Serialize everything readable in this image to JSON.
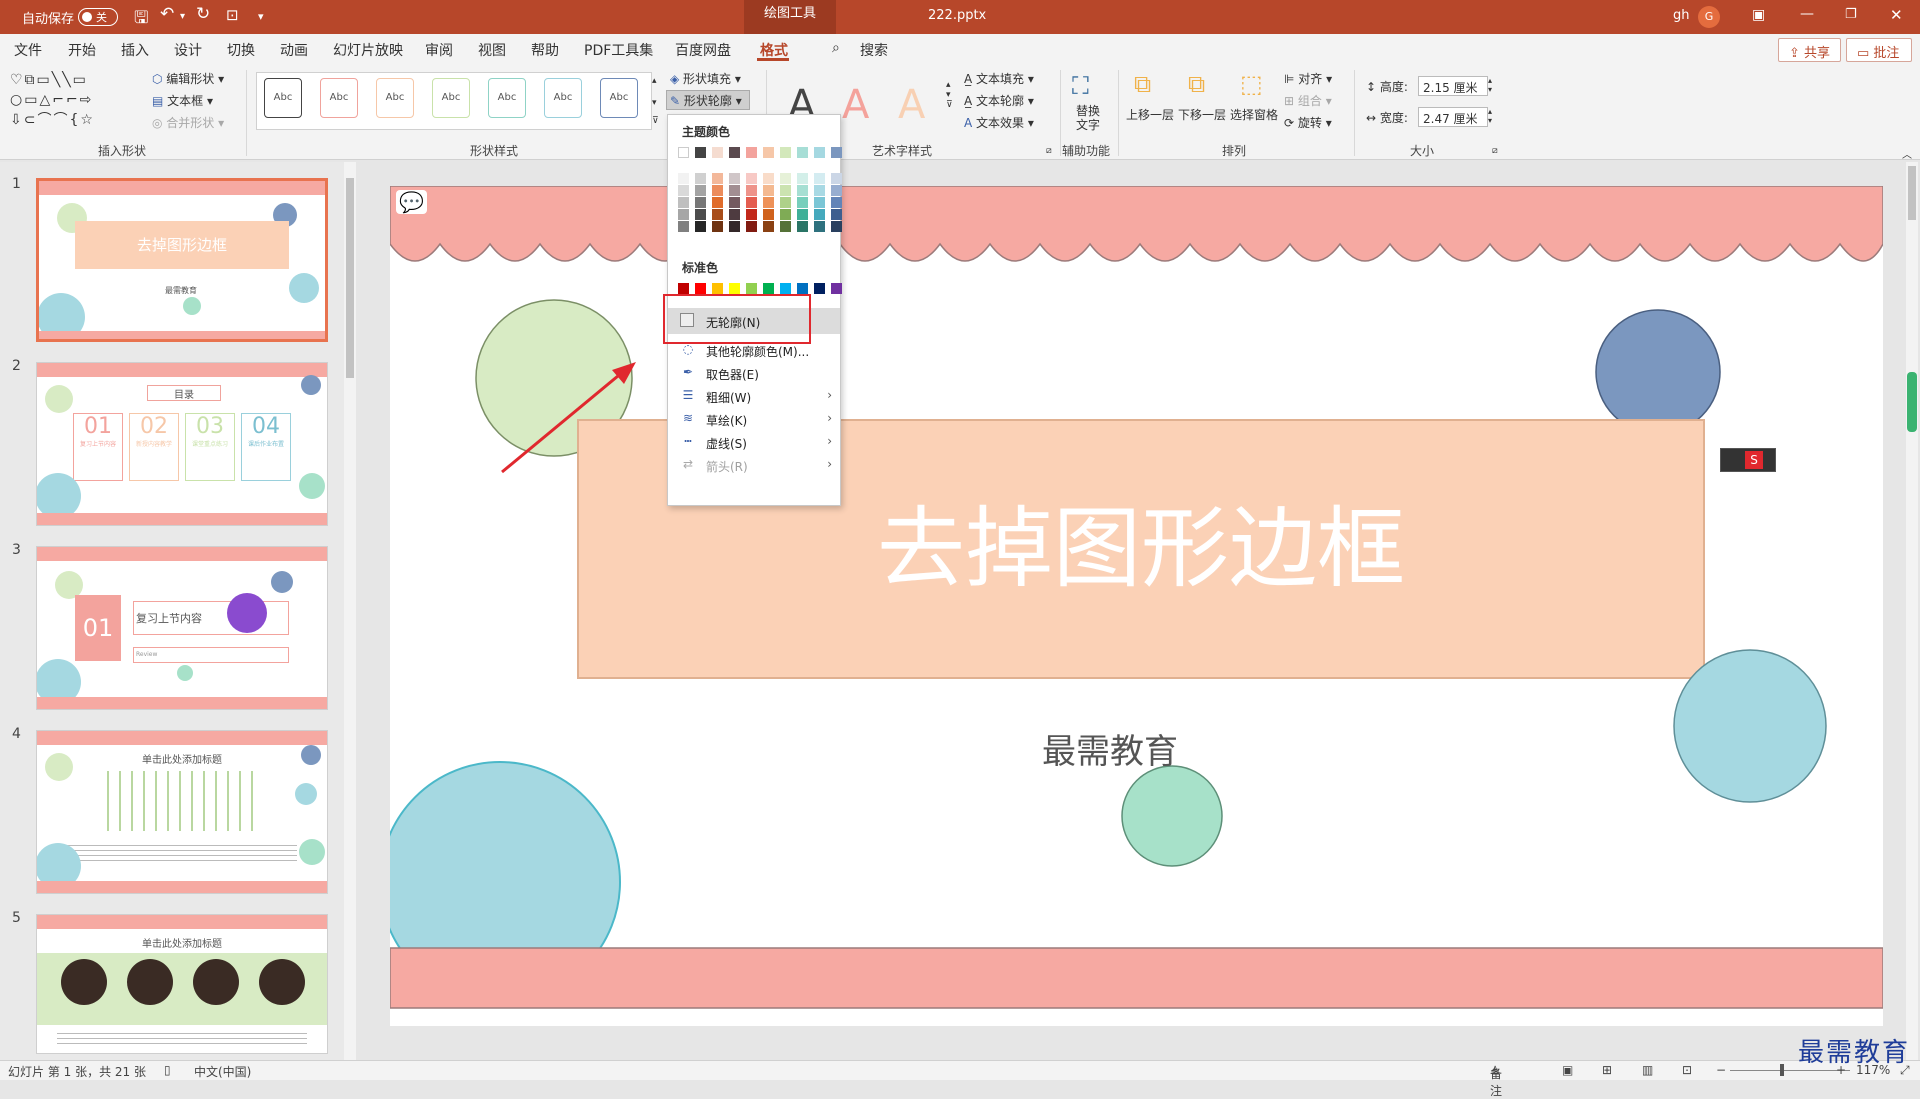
{
  "titlebar": {
    "autosave_label": "自动保存",
    "autosave_state": "关",
    "context_tab": "绘图工具",
    "filename": "222.pptx",
    "user_initials": "gh",
    "avatar_letter": "G"
  },
  "menu": {
    "items": [
      "文件",
      "开始",
      "插入",
      "设计",
      "切换",
      "动画",
      "幻灯片放映",
      "审阅",
      "视图",
      "帮助",
      "PDF工具集",
      "百度网盘",
      "格式"
    ],
    "search": "搜索",
    "share": "共享",
    "comment": "批注"
  },
  "ribbon": {
    "insert_shapes": {
      "label": "插入形状",
      "edit_shape": "编辑形状",
      "text_box": "文本框",
      "merge_shapes": "合并形状"
    },
    "shape_styles": {
      "label": "形状样式",
      "sample": "Abc",
      "fill": "形状填充",
      "outline": "形状轮廓"
    },
    "wordart": {
      "label": "艺术字样式",
      "glyph": "A",
      "text_fill": "文本填充",
      "text_outline": "文本轮廓",
      "text_effect": "文本效果"
    },
    "accessibility": {
      "label": "辅助功能",
      "alt_text": "替换文字"
    },
    "arrange": {
      "label": "排列",
      "bring_forward": "上移一层",
      "send_backward": "下移一层",
      "selection_pane": "选择窗格",
      "align": "对齐",
      "group": "组合",
      "rotate": "旋转"
    },
    "size": {
      "label": "大小",
      "height_label": "高度:",
      "height_value": "2.15 厘米",
      "width_label": "宽度:",
      "width_value": "2.47 厘米"
    }
  },
  "dropdown": {
    "theme_colors_label": "主题颜色",
    "standard_colors_label": "标准色",
    "theme_top": [
      "#ffffff",
      "#444444",
      "#f5dcd0",
      "#5b4a4f",
      "#f3a39d",
      "#f6c7a8",
      "#d3e8bb",
      "#a7ded6",
      "#a5d8e1",
      "#7b97bf"
    ],
    "theme_shades": [
      [
        "#f2f2f2",
        "#d0d0d0",
        "#f3b89a",
        "#d0c6c8",
        "#f7c9c5",
        "#f9dcc9",
        "#e6f1d8",
        "#d3efe9",
        "#d4ecf1",
        "#cbd6e6"
      ],
      [
        "#d9d9d9",
        "#a3a3a3",
        "#ec8c5c",
        "#a28e92",
        "#ee938a",
        "#f4b990",
        "#cbe3b0",
        "#a6dfd3",
        "#a8d9e4",
        "#97add0"
      ],
      [
        "#bfbfbf",
        "#777777",
        "#e06c2b",
        "#745a60",
        "#e45d50",
        "#ee9258",
        "#aed18a",
        "#77cfbc",
        "#7bc6d6",
        "#6384b8"
      ],
      [
        "#a6a6a6",
        "#4c4c4c",
        "#a84d1a",
        "#4e3b40",
        "#c2281a",
        "#d0621c",
        "#7fab55",
        "#3fb098",
        "#45a9bd",
        "#3e5e8f"
      ],
      [
        "#808080",
        "#262626",
        "#6f3311",
        "#342829",
        "#811b11",
        "#8a4113",
        "#557238",
        "#2a7566",
        "#2e717e",
        "#29405f"
      ]
    ],
    "standard": [
      "#c00000",
      "#ff0000",
      "#ffc000",
      "#ffff00",
      "#92d050",
      "#00b050",
      "#00b0f0",
      "#0070c0",
      "#002060",
      "#7030a0"
    ],
    "items": [
      {
        "label": "无轮廓(N)",
        "icon": "no-outline-icon"
      },
      {
        "label": "其他轮廓颜色(M)...",
        "icon": "palette-icon"
      },
      {
        "label": "取色器(E)",
        "icon": "eyedropper-icon"
      },
      {
        "label": "粗细(W)",
        "icon": "line-weight-icon"
      },
      {
        "label": "草绘(K)",
        "icon": "sketch-icon"
      },
      {
        "label": "虚线(S)",
        "icon": "dashes-icon"
      },
      {
        "label": "箭头(R)",
        "icon": "arrows-icon"
      }
    ]
  },
  "thumbnails": [
    {
      "num": "1",
      "title": "去掉图形边框",
      "sub": "最需教育"
    },
    {
      "num": "2",
      "title": "目录",
      "cards": [
        "01",
        "02",
        "03",
        "04"
      ],
      "card_labels": [
        "复习上节内容",
        "新授内容教学",
        "课堂重点练习",
        "课后作业布置"
      ]
    },
    {
      "num": "3",
      "card": "01",
      "title": "复习上节内容",
      "sub": "Review"
    },
    {
      "num": "4",
      "title": "单击此处添加标题"
    },
    {
      "num": "5",
      "title": "单击此处添加标题"
    }
  ],
  "slide": {
    "title": "去掉图形边框",
    "subtitle": "最需教育"
  },
  "statusbar": {
    "slide_info": "幻灯片 第 1 张，共 21 张",
    "language": "中文(中国)",
    "notes": "备注",
    "zoom": "117%"
  },
  "watermark": "最需教育"
}
